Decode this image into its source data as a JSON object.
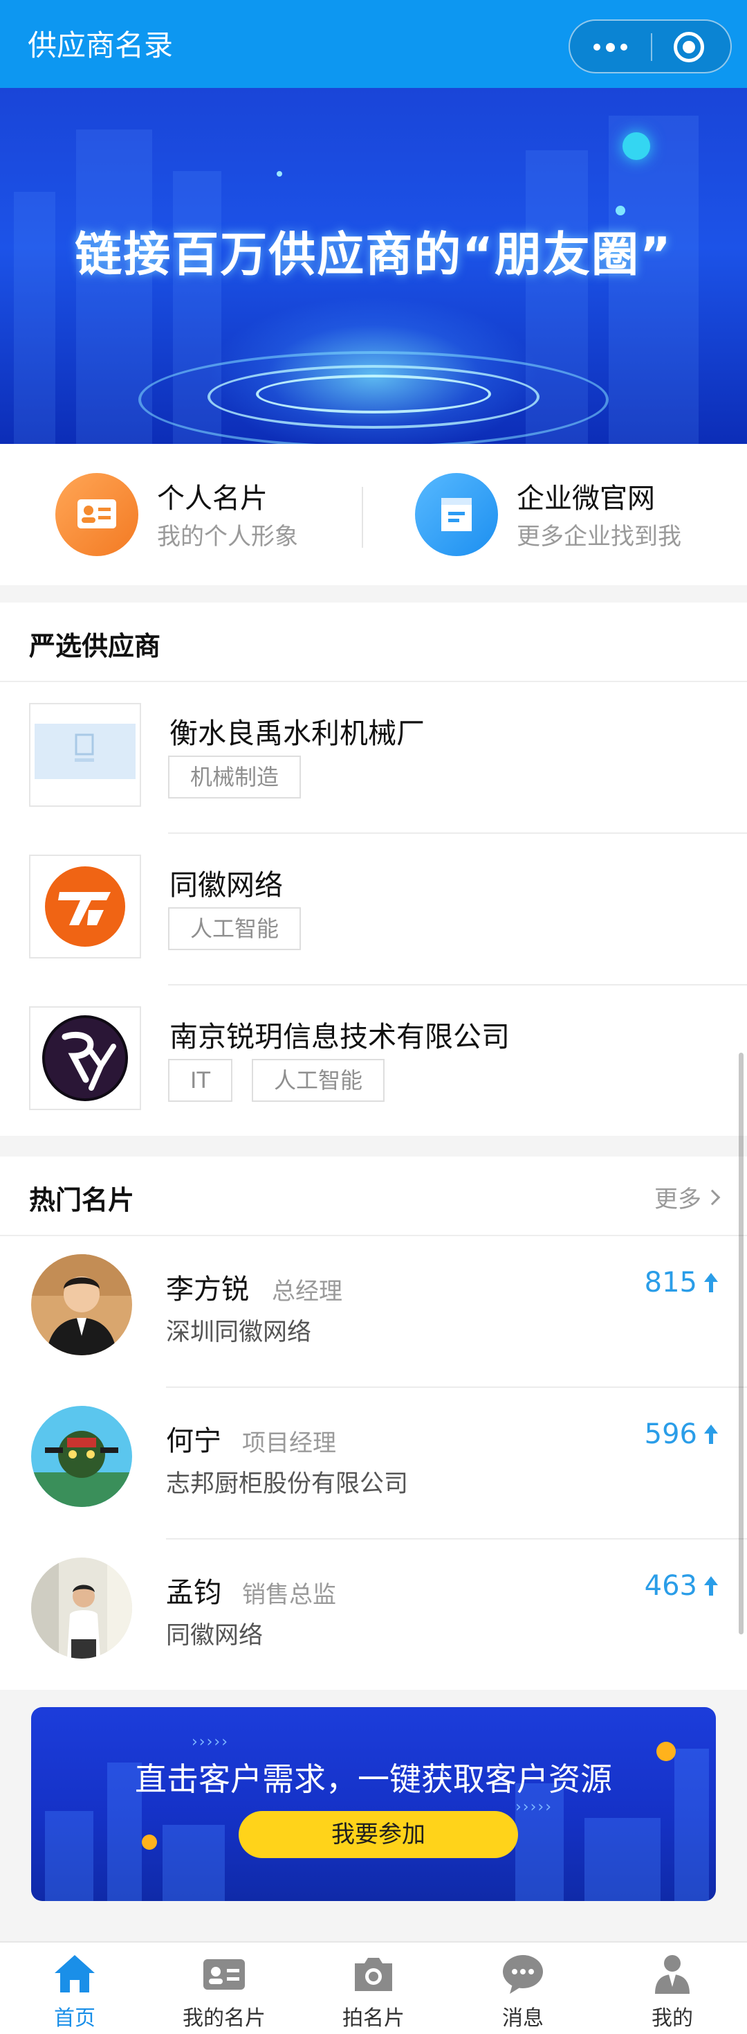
{
  "app": {
    "title": "供应商名录"
  },
  "banner": {
    "headline": "链接百万供应商的“朋友圈”"
  },
  "quick_entries": [
    {
      "name": "个人名片",
      "desc": "我的个人形象",
      "icon": "id-card-icon",
      "color": "#f58b2f"
    },
    {
      "name": "企业微官网",
      "desc": "更多企业找到我",
      "icon": "document-icon",
      "color": "#2b9bf4"
    }
  ],
  "suppliers": {
    "title": "严选供应商",
    "items": [
      {
        "name": "衡水良禹水利机械厂",
        "tags": [
          "机械制造"
        ]
      },
      {
        "name": "同徽网络",
        "tags": [
          "人工智能"
        ]
      },
      {
        "name": "南京锐玥信息技术有限公司",
        "tags": [
          "IT",
          "人工智能"
        ]
      }
    ]
  },
  "hot_cards": {
    "title": "热门名片",
    "more_label": "更多",
    "items": [
      {
        "name": "李方锐",
        "position": "总经理",
        "company": "深圳同徽网络",
        "score": "815"
      },
      {
        "name": "何宁",
        "position": "项目经理",
        "company": "志邦厨柜股份有限公司",
        "score": "596"
      },
      {
        "name": "孟钧",
        "position": "销售总监",
        "company": "同徽网络",
        "score": "463"
      }
    ]
  },
  "promo": {
    "headline": "直击客户需求，一键获取客户资源",
    "button_label": "我要参加"
  },
  "tabbar": {
    "active_color": "#1a8fe8",
    "items": [
      {
        "label": "首页",
        "icon": "home-icon"
      },
      {
        "label": "我的名片",
        "icon": "card-icon"
      },
      {
        "label": "拍名片",
        "icon": "camera-icon"
      },
      {
        "label": "消息",
        "icon": "message-icon"
      },
      {
        "label": "我的",
        "icon": "profile-icon"
      }
    ]
  }
}
